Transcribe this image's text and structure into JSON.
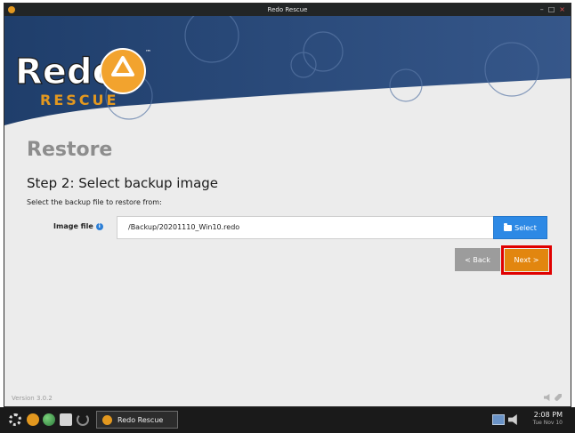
{
  "window": {
    "title": "Redo Rescue"
  },
  "banner": {
    "logo_word": "Redo",
    "logo_sub": "RESCUE",
    "logo_tm": "™"
  },
  "page": {
    "heading": "Restore",
    "step_title": "Step 2: Select backup image",
    "instruction": "Select the backup file to restore from:",
    "image_file_label": "Image file",
    "image_file_value": "/Backup/20201110_Win10.redo",
    "select_button": "Select",
    "back_button": "< Back",
    "next_button": "Next >"
  },
  "footer": {
    "version": "Version 3.0.2"
  },
  "taskbar": {
    "task_label": "Redo Rescue",
    "time": "2:08 PM",
    "date": "Tue Nov 10"
  },
  "colors": {
    "accent_blue": "#2d89e5",
    "next_orange": "#e2860f",
    "highlight_red": "#e00000",
    "banner_navy": "#2b4a78"
  }
}
